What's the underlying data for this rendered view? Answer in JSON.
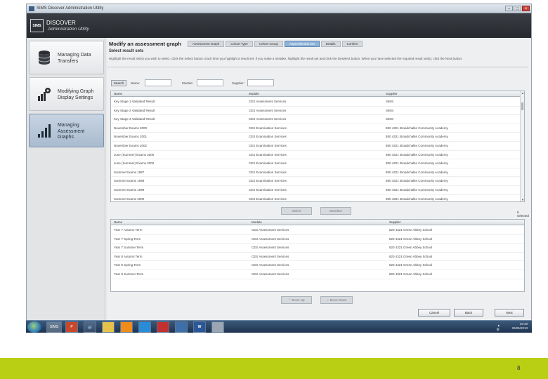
{
  "window": {
    "title": "SIMS Discover Administration Utility",
    "controls": [
      "–",
      "□",
      "×"
    ]
  },
  "header": {
    "logo": "SIMS",
    "app_name": "DISCOVER",
    "app_sub": "Administration Utility"
  },
  "sidebar": {
    "items": [
      {
        "label1": "Managing Data",
        "label2": "Transfers",
        "label3": "",
        "icon": "database-icon"
      },
      {
        "label1": "Modifying Graph",
        "label2": "Display Settings",
        "label3": "",
        "icon": "settings-chart-icon"
      },
      {
        "label1": "Managing",
        "label2": "Assessment",
        "label3": "Graphs",
        "icon": "bar-chart-icon"
      }
    ]
  },
  "main": {
    "title": "Modify an assessment graph",
    "wizard_steps": [
      "Assessment Graph",
      "Cohort Type",
      "Cohort Group",
      "Aspect/Result Set",
      "Details",
      "Confirm"
    ],
    "subtitle": "Select result sets",
    "instructions": "Highlight the result set(s) you wish to select. Click the Select button. Each time you highlight a result set, if you make a mistake, highlight the result set and click the Deselect button. When you have selected the required result set(s), click the Next button.",
    "search": {
      "button": "Search",
      "name_label": "Name:",
      "module_label": "Module:",
      "supplier_label": "Supplier:",
      "name_value": "",
      "module_value": "",
      "supplier_value": ""
    },
    "columns": [
      "Name",
      "Module",
      "Supplier"
    ],
    "available_rows": [
      [
        "Key Stage 1 Validated Result",
        "CES Assessment Services",
        "SIMS"
      ],
      [
        "Key Stage 2 Validated Result",
        "CES Assessment Services",
        "SIMS"
      ],
      [
        "Key Stage 3 Validated Result",
        "CES Assessment Services",
        "SIMS"
      ],
      [
        "November Exams 2000",
        "CES Examination Services",
        "850 4321 Broadchalke Community Academy"
      ],
      [
        "November Exams 2001",
        "CES Examination Services",
        "850 4321 Broadchalke Community Academy"
      ],
      [
        "November Exams 2002",
        "CES Examination Services",
        "850 4321 Broadchalke Community Academy"
      ],
      [
        "June (Summer) Exams 2000",
        "CES Examination Services",
        "850 4321 Broadchalke Community Academy"
      ],
      [
        "June (Summer) Exams 2002",
        "CES Examination Services",
        "850 4321 Broadchalke Community Academy"
      ],
      [
        "Summer Exams 1997",
        "CES Examination Services",
        "850 4321 Broadchalke Community Academy"
      ],
      [
        "Summer Exams 1998",
        "CES Examination Services",
        "850 4321 Broadchalke Community Academy"
      ],
      [
        "Summer Exams 1999",
        "CES Examination Services",
        "850 4321 Broadchalke Community Academy"
      ],
      [
        "Summer Exams 2000",
        "CES Examination Services",
        "850 4321 Broadchalke Community Academy"
      ]
    ],
    "select_button": "Select",
    "deselect_button": "Deselect",
    "selected_count": "6 selected",
    "selected_rows": [
      [
        "Year 7 Autumn Term",
        "CES Assessment Services",
        "820 4321 Green Abbey School"
      ],
      [
        "Year 7 Spring Term",
        "CES Assessment Services",
        "820 4321 Green Abbey School"
      ],
      [
        "Year 7 Summer Term",
        "CES Assessment Services",
        "820 4321 Green Abbey School"
      ],
      [
        "Year 8 Autumn Term",
        "CES Assessment Services",
        "820 4321 Green Abbey School"
      ],
      [
        "Year 8 Spring Term",
        "CES Assessment Services",
        "820 4321 Green Abbey School"
      ],
      [
        "Year 8 Summer Term",
        "CES Assessment Services",
        "820 4321 Green Abbey School"
      ]
    ],
    "move_up": "Move Up",
    "move_down": "Move Down",
    "cancel": "Cancel",
    "back": "Back",
    "next": "Next"
  },
  "taskbar": {
    "apps": [
      "SIMS",
      "P",
      "e",
      "",
      "",
      "",
      "",
      "",
      "W",
      ""
    ],
    "time": "16:40",
    "date": "29/05/2013"
  },
  "slide": {
    "page_number": "8",
    "band_color": "#b9cf14"
  }
}
